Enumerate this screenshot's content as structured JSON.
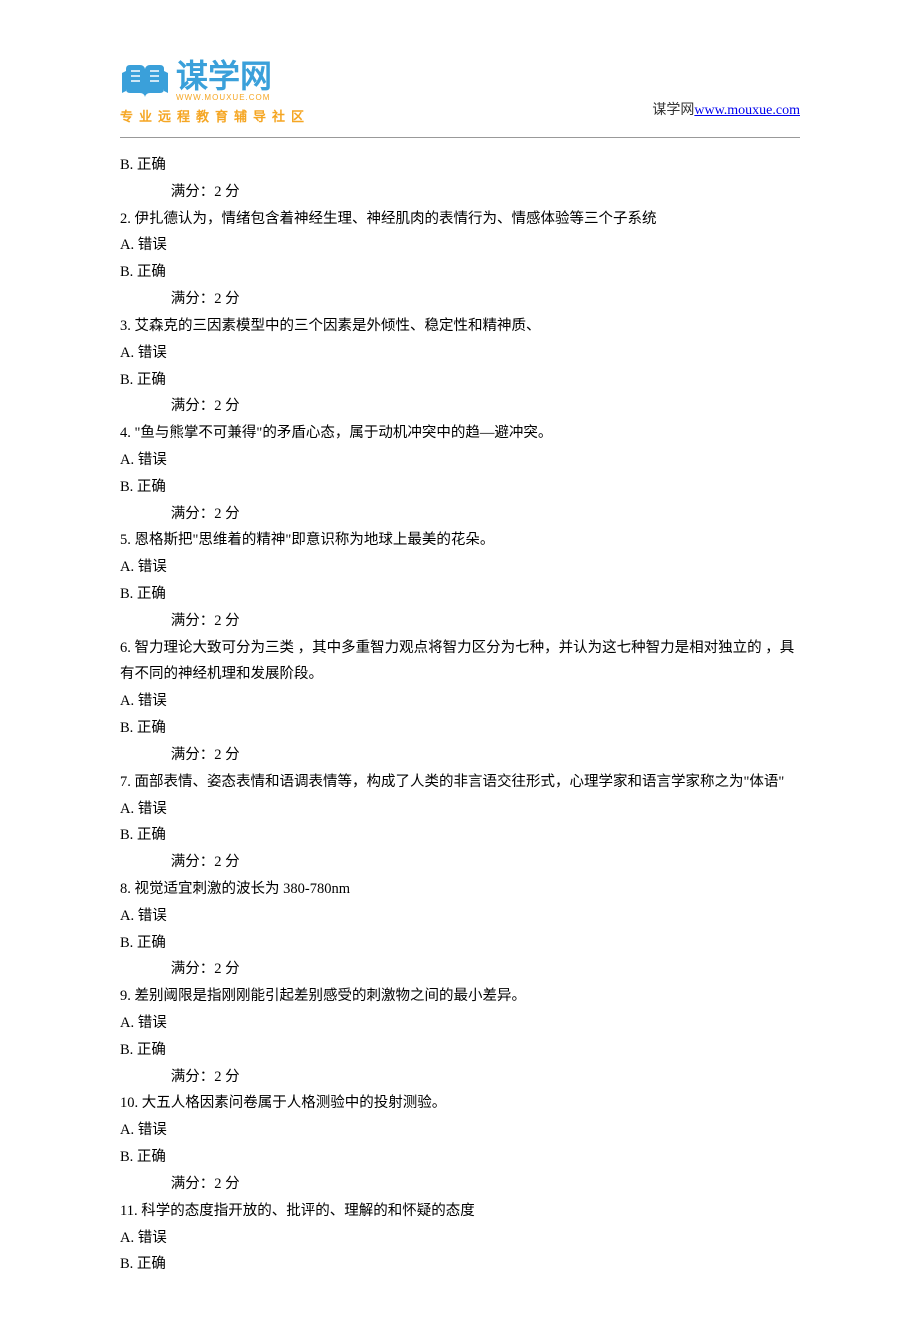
{
  "header": {
    "logo_text": "谋学网",
    "logo_sub": "WWW.MOUXUE.COM",
    "tagline": "专业远程教育辅导社区",
    "site_label": "谋学网",
    "site_url": "www.mouxue.com"
  },
  "score_label": "满分：2   分",
  "option_a": "A.  错误",
  "option_b": "B.  正确",
  "leading_b": "B.  正确",
  "questions": {
    "q2": "2.   伊扎德认为，情绪包含着神经生理、神经肌肉的表情行为、情感体验等三个子系统",
    "q3": "3.   艾森克的三因素模型中的三个因素是外倾性、稳定性和精神质、",
    "q4": "4.   \"鱼与熊掌不可兼得\"的矛盾心态，属于动机冲突中的趋—避冲突。",
    "q5": "5.   恩格斯把\"思维着的精神\"即意识称为地球上最美的花朵。",
    "q6": "6.   智力理论大致可分为三类 ，其中多重智力观点将智力区分为七种，并认为这七种智力是相对独立的 ，具有不同的神经机理和发展阶段。",
    "q7": "7.   面部表情、姿态表情和语调表情等，构成了人类的非言语交往形式，心理学家和语言学家称之为\"体语\"",
    "q8": "8.   视觉适宜刺激的波长为 380-780nm",
    "q9": "9.   差别阈限是指刚刚能引起差别感受的刺激物之间的最小差异。",
    "q10": "10.   大五人格因素问卷属于人格测验中的投射测验。",
    "q11": "11.   科学的态度指开放的、批评的、理解的和怀疑的态度"
  }
}
